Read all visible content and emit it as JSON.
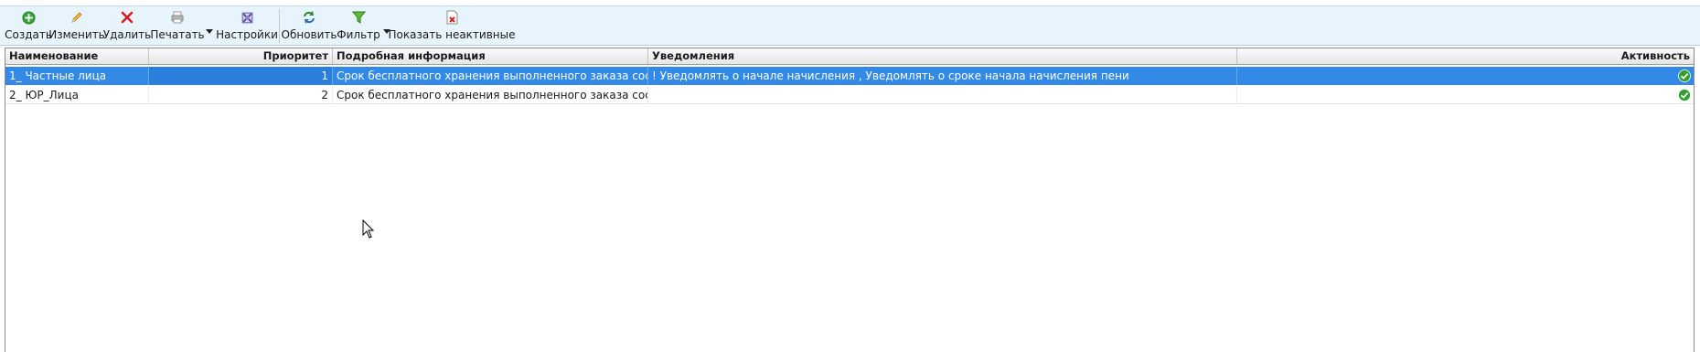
{
  "toolbar": {
    "create_label": "Создать",
    "edit_label": "Изменить",
    "delete_label": "Удалить",
    "print_label": "Печатать",
    "settings_label": "Настройки",
    "refresh_label": "Обновить",
    "filter_label": "Фильтр",
    "show_inactive_label": "Показать неактивные"
  },
  "grid": {
    "columns": [
      "Наименование",
      "Приоритет",
      "Подробная информация",
      "Уведомления",
      "Активность"
    ],
    "rows": [
      {
        "name": "1_ Частные лица",
        "priority": "1",
        "info": "Срок бесплатного хранения выполненного заказа сос",
        "notifications": "! Уведомлять о начале начисления , Уведомлять о сроке начала начисления пени",
        "active": "check-icon"
      },
      {
        "name": "2_ ЮР_Лица",
        "priority": "2",
        "info": "Срок бесплатного хранения выполненного заказа сос",
        "notifications": "",
        "active": "check-icon"
      }
    ]
  },
  "colors": {
    "toolbar_bg": "#e8f4fc",
    "selection": "#3389e6",
    "check_green": "#2e9e2e",
    "delete_red": "#d81e1e"
  }
}
